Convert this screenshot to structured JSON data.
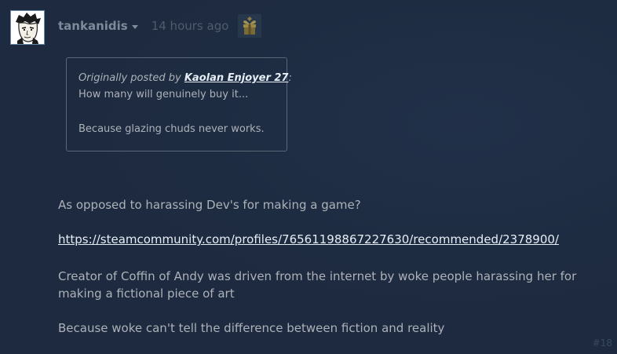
{
  "post": {
    "author": "tankanidis",
    "timestamp": "14 hours ago",
    "number": "#18",
    "quote": {
      "prefix": "Originally posted by ",
      "author": "Kaolan Enjoyer 27",
      "suffix": ":",
      "line1": "How many will genuinely buy it...",
      "line2": "Because glazing chuds never works."
    },
    "paragraph1": "As opposed to harassing Dev's for making a game?",
    "link": "https://steamcommunity.com/profiles/76561198867227630/recommended/2378900/",
    "paragraph2": "Creator of Coffin of Andy was driven from the internet by woke people harassing her for making a fictional piece of art",
    "paragraph3": "Because woke can't tell the difference between fiction and reality"
  },
  "icons": {
    "avatar": "user-avatar-icon",
    "dropdown": "chevron-down-icon",
    "award": "award-badge-icon"
  },
  "colors": {
    "background": "#1d2a3f",
    "text": "#acb2b8",
    "link": "#e6eef5",
    "author": "#7d8a99",
    "timestamp": "#4e5c6c"
  }
}
